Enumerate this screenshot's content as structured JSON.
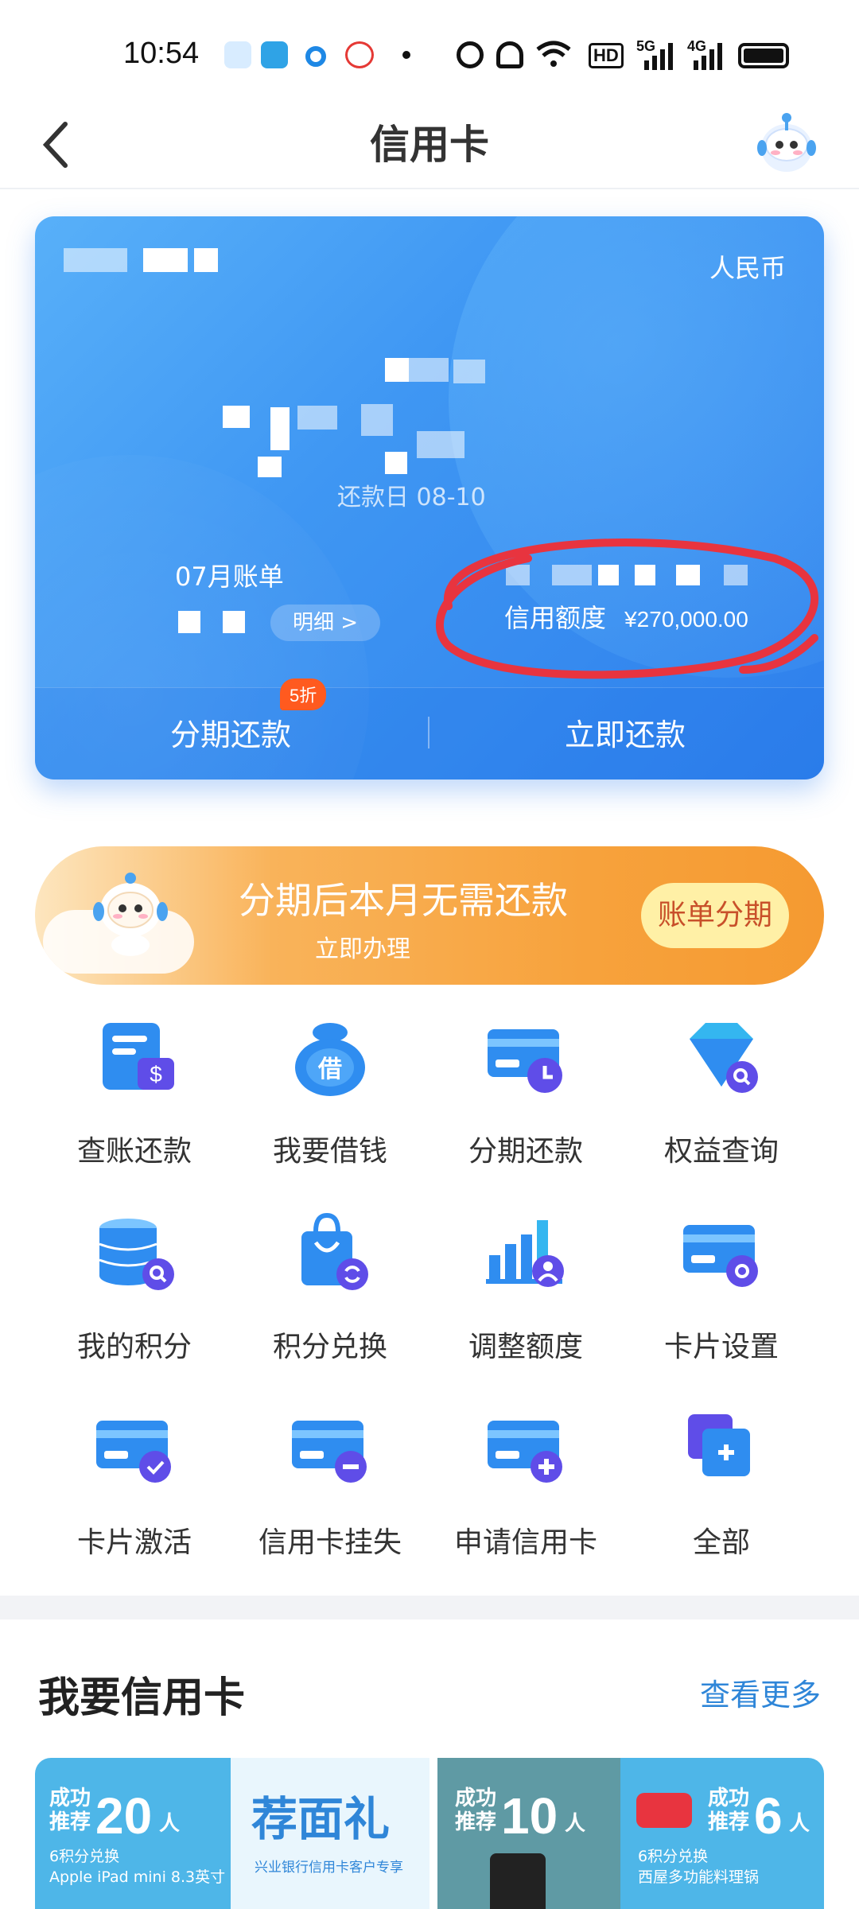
{
  "status_bar": {
    "time": "10:54",
    "net1": "5G",
    "net2": "4G",
    "hd": "HD"
  },
  "nav": {
    "title": "信用卡"
  },
  "card": {
    "currency": "人民币",
    "due_text": "还款日 08-10",
    "bill_month": "07月账单",
    "detail_button": "明细 >",
    "limit_label": "信用额度",
    "limit_value": "¥270,000.00",
    "installment_badge": "5折",
    "action_installment": "分期还款",
    "action_repay": "立即还款"
  },
  "promo": {
    "title": "分期后本月无需还款",
    "subtitle": "立即办理",
    "button": "账单分期"
  },
  "grid": [
    {
      "label": "查账还款",
      "icon": "bill-repay-icon"
    },
    {
      "label": "我要借钱",
      "icon": "borrow-money-icon"
    },
    {
      "label": "分期还款",
      "icon": "installment-icon"
    },
    {
      "label": "权益查询",
      "icon": "benefits-diamond-icon"
    },
    {
      "label": "我的积分",
      "icon": "points-icon"
    },
    {
      "label": "积分兑换",
      "icon": "points-exchange-icon"
    },
    {
      "label": "调整额度",
      "icon": "adjust-limit-icon"
    },
    {
      "label": "卡片设置",
      "icon": "card-settings-icon"
    },
    {
      "label": "卡片激活",
      "icon": "card-activate-icon"
    },
    {
      "label": "信用卡挂失",
      "icon": "card-report-loss-icon"
    },
    {
      "label": "申请信用卡",
      "icon": "apply-card-icon"
    },
    {
      "label": "全部",
      "icon": "all-services-icon"
    }
  ],
  "section": {
    "title": "我要信用卡",
    "more": "查看更多"
  },
  "tiles": [
    {
      "prefix1": "成功",
      "prefix2": "推荐",
      "number": "20",
      "unit": "人",
      "desc1": "6积分兑换",
      "desc2": "Apple iPad mini 8.3英寸"
    },
    {
      "headline": "荐面礼",
      "desc": "兴业银行信用卡客户专享"
    },
    {
      "prefix1": "成功",
      "prefix2": "推荐",
      "number": "10",
      "unit": "人"
    },
    {
      "prefix1": "成功",
      "prefix2": "推荐",
      "number": "6",
      "unit": "人",
      "desc1": "6积分兑换",
      "desc2": "西屋多功能料理锅"
    }
  ]
}
